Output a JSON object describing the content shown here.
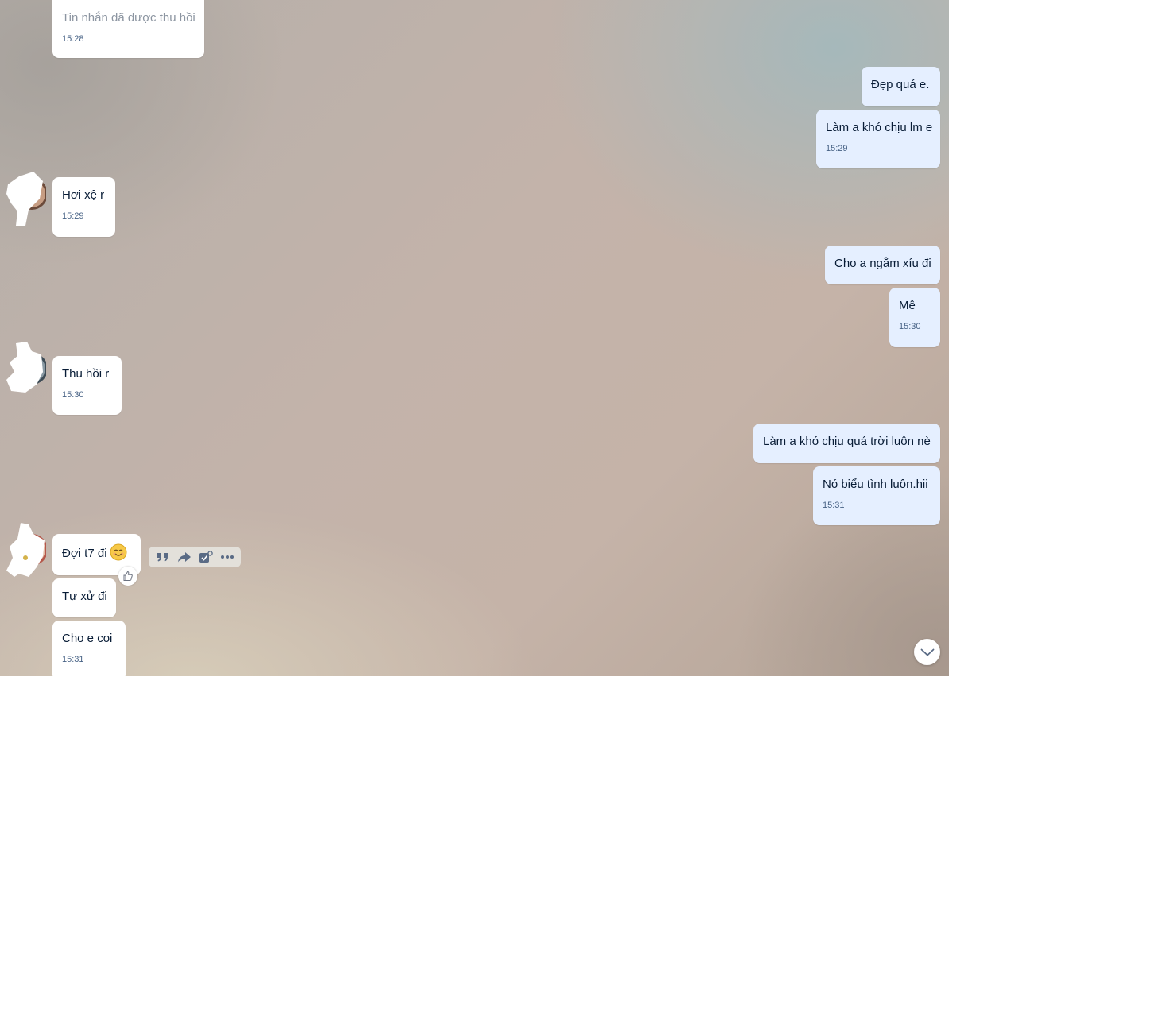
{
  "messages": [
    {
      "side": "in",
      "text": "Tin nhắn đã được thu hồi",
      "time": "15:28",
      "recalled": true
    },
    {
      "side": "out",
      "text": "Đẹp quá e.",
      "time": ""
    },
    {
      "side": "out",
      "text": "Làm a khó chịu lm e",
      "time": "15:29"
    },
    {
      "side": "in",
      "text": "Hơi xệ r",
      "time": "15:29"
    },
    {
      "side": "out",
      "text": "Cho a ngắm xíu đi",
      "time": ""
    },
    {
      "side": "out",
      "text": "Mê",
      "time": "15:30"
    },
    {
      "side": "in",
      "text": "Thu hồi r",
      "time": "15:30"
    },
    {
      "side": "out",
      "text": "Làm a khó chịu quá trời luôn nè",
      "time": ""
    },
    {
      "side": "out",
      "text": "Nó biểu tình luôn.hii",
      "time": "15:31"
    },
    {
      "side": "in",
      "text": "Đợi t7 đi",
      "time": "",
      "emoji": "smiling-face-emoji"
    },
    {
      "side": "in",
      "text": "Tự xử đi",
      "time": ""
    },
    {
      "side": "in",
      "text": "Cho e coi",
      "time": "15:31"
    }
  ],
  "hover_toolbar": {
    "icons": [
      "quote-icon",
      "forward-icon",
      "task-icon",
      "more-icon"
    ]
  },
  "reaction_icon": "thumbs-up-icon",
  "scroll_down_icon": "chevron-down-icon",
  "colors": {
    "incoming_bubble": "#ffffff",
    "outgoing_bubble": "#e5efff",
    "text": "#081c36",
    "time": "#476285",
    "recalled_text": "#8c95a1"
  }
}
